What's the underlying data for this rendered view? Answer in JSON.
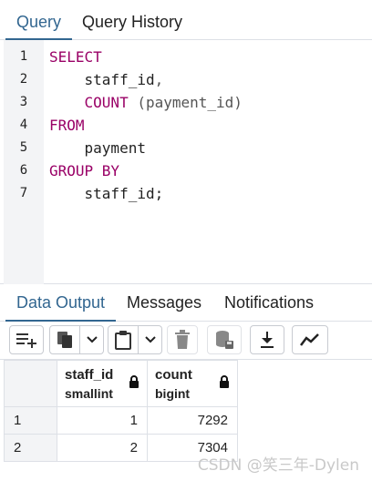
{
  "query_tabs": [
    {
      "label": "Query",
      "active": true
    },
    {
      "label": "Query History",
      "active": false
    }
  ],
  "editor": {
    "lines": [
      {
        "num": "1",
        "parts": [
          {
            "t": "SELECT",
            "c": "kw"
          }
        ]
      },
      {
        "num": "2",
        "parts": [
          {
            "t": "    staff_id",
            "c": ""
          },
          {
            "t": ",",
            "c": "punct"
          }
        ]
      },
      {
        "num": "3",
        "parts": [
          {
            "t": "    ",
            "c": ""
          },
          {
            "t": "COUNT",
            "c": "kw"
          },
          {
            "t": " (payment_id)",
            "c": "punct"
          }
        ]
      },
      {
        "num": "4",
        "parts": [
          {
            "t": "FROM",
            "c": "kw"
          }
        ]
      },
      {
        "num": "5",
        "parts": [
          {
            "t": "    payment",
            "c": ""
          }
        ]
      },
      {
        "num": "6",
        "parts": [
          {
            "t": "GROUP BY",
            "c": "kw"
          }
        ]
      },
      {
        "num": "7",
        "parts": [
          {
            "t": "    staff_id;",
            "c": ""
          }
        ]
      }
    ]
  },
  "output_tabs": [
    {
      "label": "Data Output",
      "active": true
    },
    {
      "label": "Messages",
      "active": false
    },
    {
      "label": "Notifications",
      "active": false
    }
  ],
  "toolbar": {
    "icons": [
      "add-row-icon",
      "copy-icon",
      "chevron-down-icon",
      "paste-icon",
      "chevron-down-icon",
      "delete-icon",
      "save-data-icon",
      "download-icon",
      "graph-icon"
    ]
  },
  "grid": {
    "columns": [
      {
        "name": "staff_id",
        "type": "smallint"
      },
      {
        "name": "count",
        "type": "bigint"
      }
    ],
    "rows": [
      {
        "num": "1",
        "cells": [
          "1",
          "7292"
        ]
      },
      {
        "num": "2",
        "cells": [
          "2",
          "7304"
        ]
      }
    ]
  },
  "watermark": "CSDN @笑三年-Dylen",
  "colors": {
    "accent": "#326690",
    "keyword": "#990066",
    "gutter": "#f3f4f6"
  }
}
